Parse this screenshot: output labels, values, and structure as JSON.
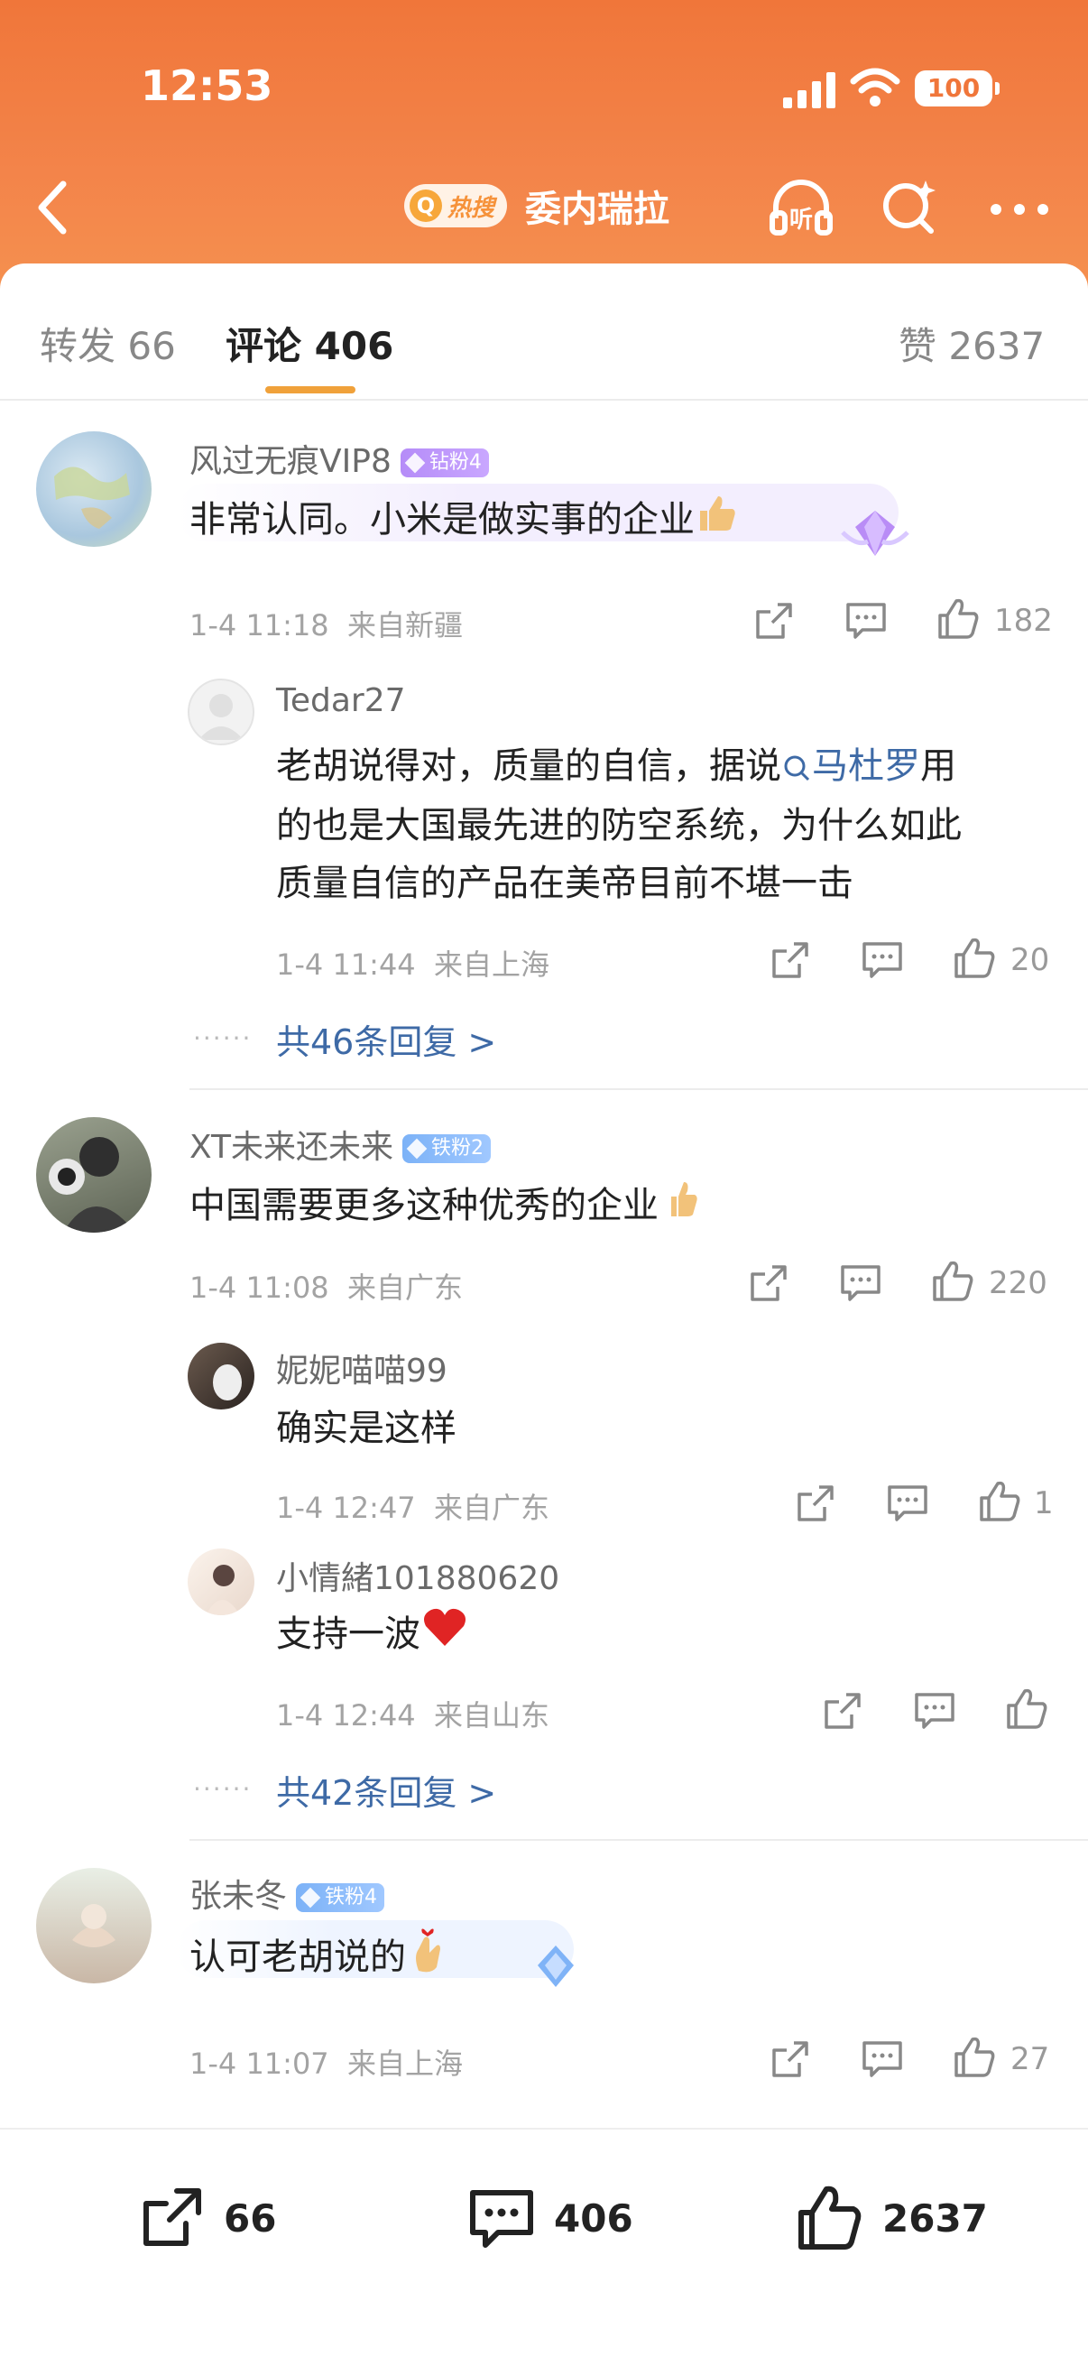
{
  "status_bar": {
    "time": "12:53",
    "battery": "100"
  },
  "nav": {
    "hot_label": "热搜",
    "title": "委内瑞拉"
  },
  "tabs": {
    "repost_label": "转发",
    "repost_count": "66",
    "comment_label": "评论",
    "comment_count": "406",
    "like_label": "赞",
    "like_count": "2637"
  },
  "comments": [
    {
      "user": "风过无痕VIP8",
      "badge": "钻粉4",
      "text": "非常认同。小米是做实事的企业",
      "time": "1-4 11:18",
      "location": "来自新疆",
      "likes": "182",
      "replies": [
        {
          "user": "Tedar27",
          "text_line1_before": "老胡说得对，质量的自信，据说",
          "link": "马杜罗",
          "text_line1_after": "用",
          "text_line2": "的也是大国最先进的防空系统，为什么如此",
          "text_line3": "质量自信的产品在美帝目前不堪一击",
          "time": "1-4 11:44",
          "location": "来自上海",
          "likes": "20"
        }
      ],
      "more_replies": "共46条回复 >"
    },
    {
      "user": "XT未来还未来",
      "badge": "铁粉2",
      "text": "中国需要更多这种优秀的企业",
      "time": "1-4 11:08",
      "location": "来自广东",
      "likes": "220",
      "replies": [
        {
          "user": "妮妮喵喵99",
          "text": "确实是这样",
          "time": "1-4 12:47",
          "location": "来自广东",
          "likes": "1"
        },
        {
          "user": "小情緒101880620",
          "text": "支持一波",
          "time": "1-4 12:44",
          "location": "来自山东",
          "likes": ""
        }
      ],
      "more_replies": "共42条回复 >"
    },
    {
      "user": "张未冬",
      "badge": "铁粉4",
      "text": "认可老胡说的",
      "time": "1-4 11:07",
      "location": "来自上海",
      "likes": "27"
    }
  ],
  "bottom_bar": {
    "repost": "66",
    "comment": "406",
    "like": "2637"
  },
  "colors": {
    "header": "#f0763a",
    "link": "#3e6aa6",
    "tab_indicator": "#f0a13a"
  }
}
